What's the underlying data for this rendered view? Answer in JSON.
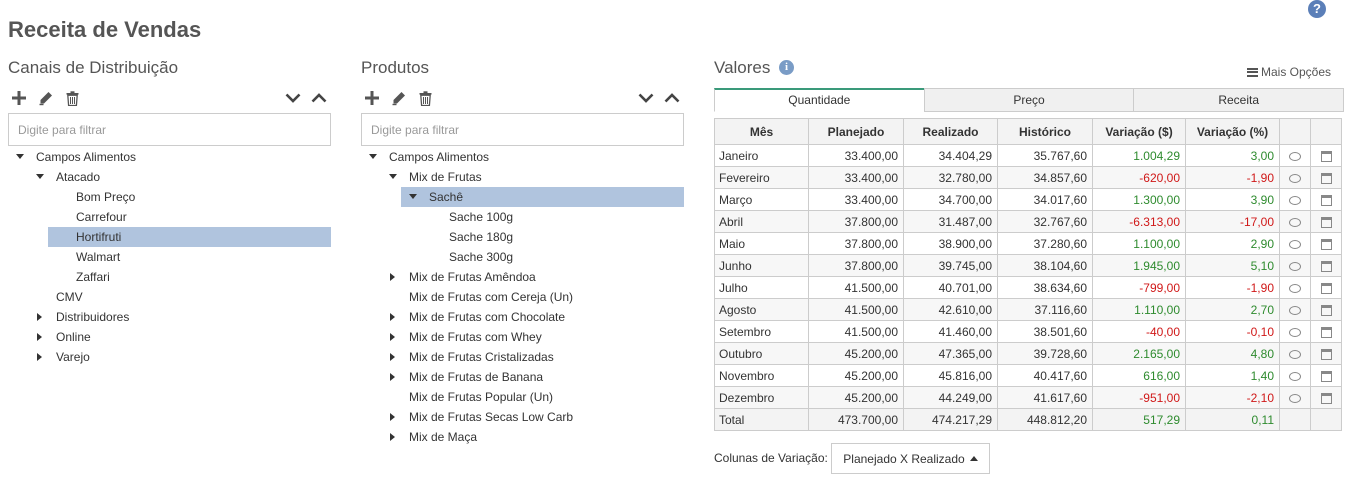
{
  "page": {
    "title": "Receita de Vendas"
  },
  "channels": {
    "title": "Canais de Distribuição",
    "filter_placeholder": "Digite para filtrar",
    "tree": [
      {
        "label": "Campos Alimentos",
        "level": 0,
        "caret": "down",
        "selected": false
      },
      {
        "label": "Atacado",
        "level": 1,
        "caret": "down",
        "selected": false
      },
      {
        "label": "Bom Preço",
        "level": 2,
        "caret": "none",
        "selected": false
      },
      {
        "label": "Carrefour",
        "level": 2,
        "caret": "none",
        "selected": false
      },
      {
        "label": "Hortifruti",
        "level": 2,
        "caret": "none",
        "selected": true
      },
      {
        "label": "Walmart",
        "level": 2,
        "caret": "none",
        "selected": false
      },
      {
        "label": "Zaffari",
        "level": 2,
        "caret": "none",
        "selected": false
      },
      {
        "label": "CMV",
        "level": 1,
        "caret": "none",
        "selected": false
      },
      {
        "label": "Distribuidores",
        "level": 1,
        "caret": "right",
        "selected": false
      },
      {
        "label": "Online",
        "level": 1,
        "caret": "right",
        "selected": false
      },
      {
        "label": "Varejo",
        "level": 1,
        "caret": "right",
        "selected": false
      }
    ]
  },
  "products": {
    "title": "Produtos",
    "filter_placeholder": "Digite para filtrar",
    "tree": [
      {
        "label": "Campos Alimentos",
        "level": 0,
        "caret": "down",
        "selected": false
      },
      {
        "label": "Mix de Frutas",
        "level": 1,
        "caret": "down",
        "selected": false
      },
      {
        "label": "Sachê",
        "level": 2,
        "caret": "down",
        "selected": true
      },
      {
        "label": "Sache 100g",
        "level": 3,
        "caret": "none",
        "selected": false
      },
      {
        "label": "Sache 180g",
        "level": 3,
        "caret": "none",
        "selected": false
      },
      {
        "label": "Sache 300g",
        "level": 3,
        "caret": "none",
        "selected": false
      },
      {
        "label": "Mix de Frutas Amêndoa",
        "level": 1,
        "caret": "right",
        "selected": false
      },
      {
        "label": "Mix de Frutas com Cereja (Un)",
        "level": 1,
        "caret": "none",
        "selected": false
      },
      {
        "label": "Mix de Frutas com Chocolate",
        "level": 1,
        "caret": "right",
        "selected": false
      },
      {
        "label": "Mix de Frutas com Whey",
        "level": 1,
        "caret": "right",
        "selected": false
      },
      {
        "label": "Mix de Frutas Cristalizadas",
        "level": 1,
        "caret": "right",
        "selected": false
      },
      {
        "label": "Mix de Frutas de Banana",
        "level": 1,
        "caret": "right",
        "selected": false
      },
      {
        "label": "Mix de Frutas Popular (Un)",
        "level": 1,
        "caret": "none",
        "selected": false
      },
      {
        "label": "Mix de Frutas Secas Low Carb",
        "level": 1,
        "caret": "right",
        "selected": false
      },
      {
        "label": "Mix de Maça",
        "level": 1,
        "caret": "right",
        "selected": false
      }
    ]
  },
  "values": {
    "title": "Valores",
    "more_options": "Mais Opções",
    "tabs": [
      {
        "label": "Quantidade",
        "active": true
      },
      {
        "label": "Preço",
        "active": false
      },
      {
        "label": "Receita",
        "active": false
      }
    ],
    "columns": [
      "Mês",
      "Planejado",
      "Realizado",
      "Histórico",
      "Variação ($)",
      "Variação (%)"
    ],
    "rows": [
      {
        "month": "Janeiro",
        "planned": "33.400,00",
        "actual": "34.404,29",
        "history": "35.767,60",
        "var_abs": "1.004,29",
        "var_pct": "3,00",
        "sign": "pos"
      },
      {
        "month": "Fevereiro",
        "planned": "33.400,00",
        "actual": "32.780,00",
        "history": "34.857,60",
        "var_abs": "-620,00",
        "var_pct": "-1,90",
        "sign": "neg"
      },
      {
        "month": "Março",
        "planned": "33.400,00",
        "actual": "34.700,00",
        "history": "34.017,60",
        "var_abs": "1.300,00",
        "var_pct": "3,90",
        "sign": "pos"
      },
      {
        "month": "Abril",
        "planned": "37.800,00",
        "actual": "31.487,00",
        "history": "32.767,60",
        "var_abs": "-6.313,00",
        "var_pct": "-17,00",
        "sign": "neg"
      },
      {
        "month": "Maio",
        "planned": "37.800,00",
        "actual": "38.900,00",
        "history": "37.280,60",
        "var_abs": "1.100,00",
        "var_pct": "2,90",
        "sign": "pos"
      },
      {
        "month": "Junho",
        "planned": "37.800,00",
        "actual": "39.745,00",
        "history": "38.104,60",
        "var_abs": "1.945,00",
        "var_pct": "5,10",
        "sign": "pos"
      },
      {
        "month": "Julho",
        "planned": "41.500,00",
        "actual": "40.701,00",
        "history": "38.634,60",
        "var_abs": "-799,00",
        "var_pct": "-1,90",
        "sign": "neg"
      },
      {
        "month": "Agosto",
        "planned": "41.500,00",
        "actual": "42.610,00",
        "history": "37.116,60",
        "var_abs": "1.110,00",
        "var_pct": "2,70",
        "sign": "pos"
      },
      {
        "month": "Setembro",
        "planned": "41.500,00",
        "actual": "41.460,00",
        "history": "38.501,60",
        "var_abs": "-40,00",
        "var_pct": "-0,10",
        "sign": "neg"
      },
      {
        "month": "Outubro",
        "planned": "45.200,00",
        "actual": "47.365,00",
        "history": "39.728,60",
        "var_abs": "2.165,00",
        "var_pct": "4,80",
        "sign": "pos"
      },
      {
        "month": "Novembro",
        "planned": "45.200,00",
        "actual": "45.816,00",
        "history": "40.417,60",
        "var_abs": "616,00",
        "var_pct": "1,40",
        "sign": "pos"
      },
      {
        "month": "Dezembro",
        "planned": "45.200,00",
        "actual": "44.249,00",
        "history": "41.617,60",
        "var_abs": "-951,00",
        "var_pct": "-2,10",
        "sign": "neg"
      }
    ],
    "total": {
      "month": "Total",
      "planned": "473.700,00",
      "actual": "474.217,29",
      "history": "448.812,20",
      "var_abs": "517,29",
      "var_pct": "0,11",
      "sign": "pos"
    },
    "variation_label": "Colunas de Variação:",
    "variation_value": "Planejado X Realizado"
  }
}
